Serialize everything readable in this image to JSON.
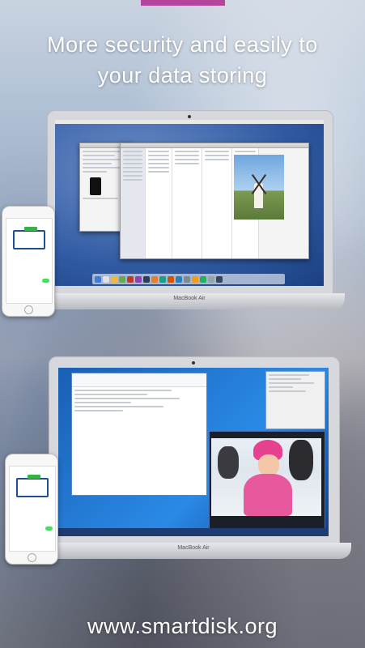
{
  "headline": {
    "line1": "More security and easily to",
    "line2": "your data storing"
  },
  "footer": {
    "url": "www.smartdisk.org"
  },
  "laptops": {
    "brand": "MacBook Air"
  },
  "colors": {
    "accent_top": "#b5459a",
    "toggle_on": "#4cd964",
    "badge_green": "#35b24a",
    "monitor_blue": "#1d4f91"
  }
}
